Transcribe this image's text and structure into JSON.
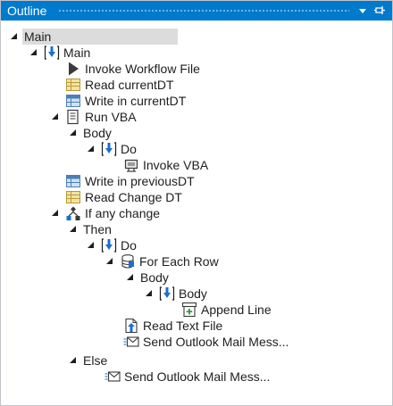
{
  "panel": {
    "title": "Outline",
    "colors": {
      "titlebar": "#007acc",
      "selected": "#dcdcdc",
      "text": "#1e1e1e"
    }
  },
  "tree": {
    "n0": {
      "label": "Main",
      "icon": "none"
    },
    "n1": {
      "label": "Main",
      "icon": "sequence-icon"
    },
    "n2": {
      "label": "Invoke Workflow File",
      "icon": "play-icon"
    },
    "n3": {
      "label": "Read currentDT",
      "icon": "read-range-icon"
    },
    "n4": {
      "label": "Write in currentDT",
      "icon": "write-range-icon"
    },
    "n5": {
      "label": "Run VBA",
      "icon": "document-icon"
    },
    "n6": {
      "label": "Body",
      "icon": "none"
    },
    "n7": {
      "label": "Do",
      "icon": "sequence-icon"
    },
    "n8": {
      "label": "Invoke VBA",
      "icon": "invoke-vba-icon"
    },
    "n9": {
      "label": "Write in previousDT",
      "icon": "write-range-icon"
    },
    "n10": {
      "label": "Read Change DT",
      "icon": "read-range-icon"
    },
    "n11": {
      "label": "If any change",
      "icon": "if-icon"
    },
    "n12": {
      "label": "Then",
      "icon": "none"
    },
    "n13": {
      "label": "Do",
      "icon": "sequence-icon"
    },
    "n14": {
      "label": "For Each Row",
      "icon": "for-each-row-icon"
    },
    "n15": {
      "label": "Body",
      "icon": "none"
    },
    "n16": {
      "label": "Body",
      "icon": "sequence-icon"
    },
    "n17": {
      "label": "Append Line",
      "icon": "append-line-icon"
    },
    "n18": {
      "label": "Read Text File",
      "icon": "read-text-file-icon"
    },
    "n19": {
      "label": "Send Outlook Mail Mess...",
      "icon": "mail-icon"
    },
    "n20": {
      "label": "Else",
      "icon": "none"
    },
    "n21": {
      "label": "Send Outlook Mail Mess...",
      "icon": "mail-icon"
    }
  }
}
